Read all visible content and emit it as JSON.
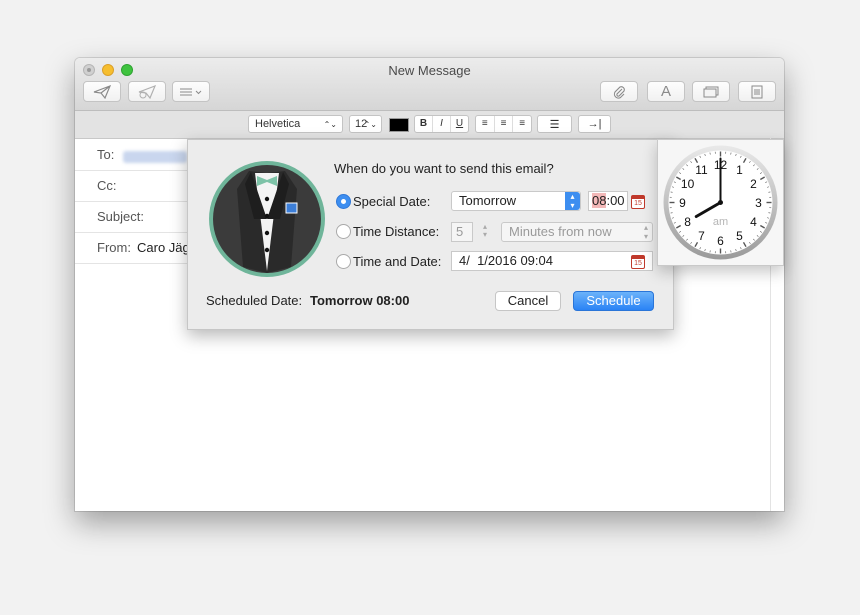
{
  "window": {
    "title": "New Message"
  },
  "format_bar": {
    "font": "Helvetica",
    "size": "12",
    "style_buttons": [
      "B",
      "I",
      "U"
    ],
    "align_buttons": [
      "≡",
      "≡",
      "≡"
    ],
    "list_button": "☰",
    "indent_button": "→|"
  },
  "headers": {
    "to_label": "To:",
    "cc_label": "Cc:",
    "subject_label": "Subject:",
    "from_label": "From:",
    "from_value": "Caro Jäg"
  },
  "dialog": {
    "question": "When do you want to send this email?",
    "options": {
      "special_date": {
        "label": "Special Date:",
        "value": "Tomorrow",
        "time_hl": "08",
        "time_rest": ":00",
        "selected": true
      },
      "time_distance": {
        "label": "Time Distance:",
        "value": "5",
        "unit": "Minutes from now"
      },
      "time_and_date": {
        "label": "Time and Date:",
        "value": "4/  1/2016 09:04"
      }
    },
    "scheduled_label": "Scheduled Date:",
    "scheduled_value": "Tomorrow 08:00",
    "cancel_label": "Cancel",
    "schedule_label": "Schedule",
    "calendar_day": "15"
  },
  "clock": {
    "numbers": [
      "12",
      "1",
      "2",
      "3",
      "4",
      "5",
      "6",
      "7",
      "8",
      "9",
      "10",
      "11"
    ],
    "ampm": "am",
    "hour": 8,
    "minute": 0
  },
  "colors": {
    "accent": "#3d8ef0",
    "calendar": "#c0392b"
  }
}
